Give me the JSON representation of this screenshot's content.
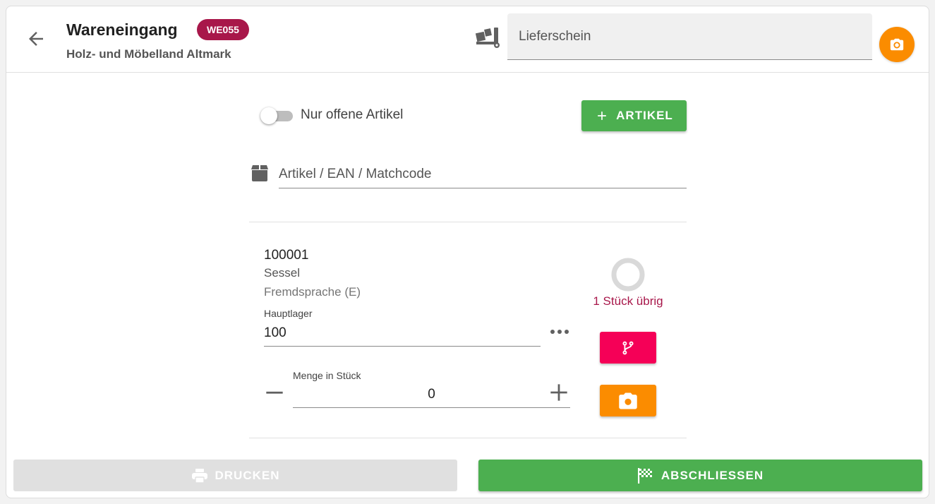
{
  "header": {
    "title": "Wareneingang",
    "badge": "WE055",
    "subtitle": "Holz- und Möbelland Altmark",
    "lieferschein_placeholder": "Lieferschein",
    "icons": {
      "back": "arrow-left-icon",
      "truck": "truck-loading-icon",
      "camera": "camera-icon"
    }
  },
  "filter": {
    "toggle_label": "Nur offene Artikel",
    "toggle_on": false,
    "add_button_label": "ARTIKEL"
  },
  "search": {
    "placeholder": "Artikel / EAN / Matchcode",
    "icon": "box-icon"
  },
  "item": {
    "number": "100001",
    "name": "Sessel",
    "language": "Fremdsprache (E)",
    "lager_label": "Hauptlager",
    "lager_value": "100",
    "menge_label": "Menge in Stück",
    "menge_value": "0",
    "remaining_text": "1 Stück übrig",
    "progress": 0
  },
  "footer": {
    "print_label": "DRUCKEN",
    "finish_label": "ABSCHLIESSEN"
  },
  "colors": {
    "accent_green": "#4caf50",
    "badge": "#a8174a",
    "orange": "#fb8c00",
    "pink": "#f50057"
  }
}
